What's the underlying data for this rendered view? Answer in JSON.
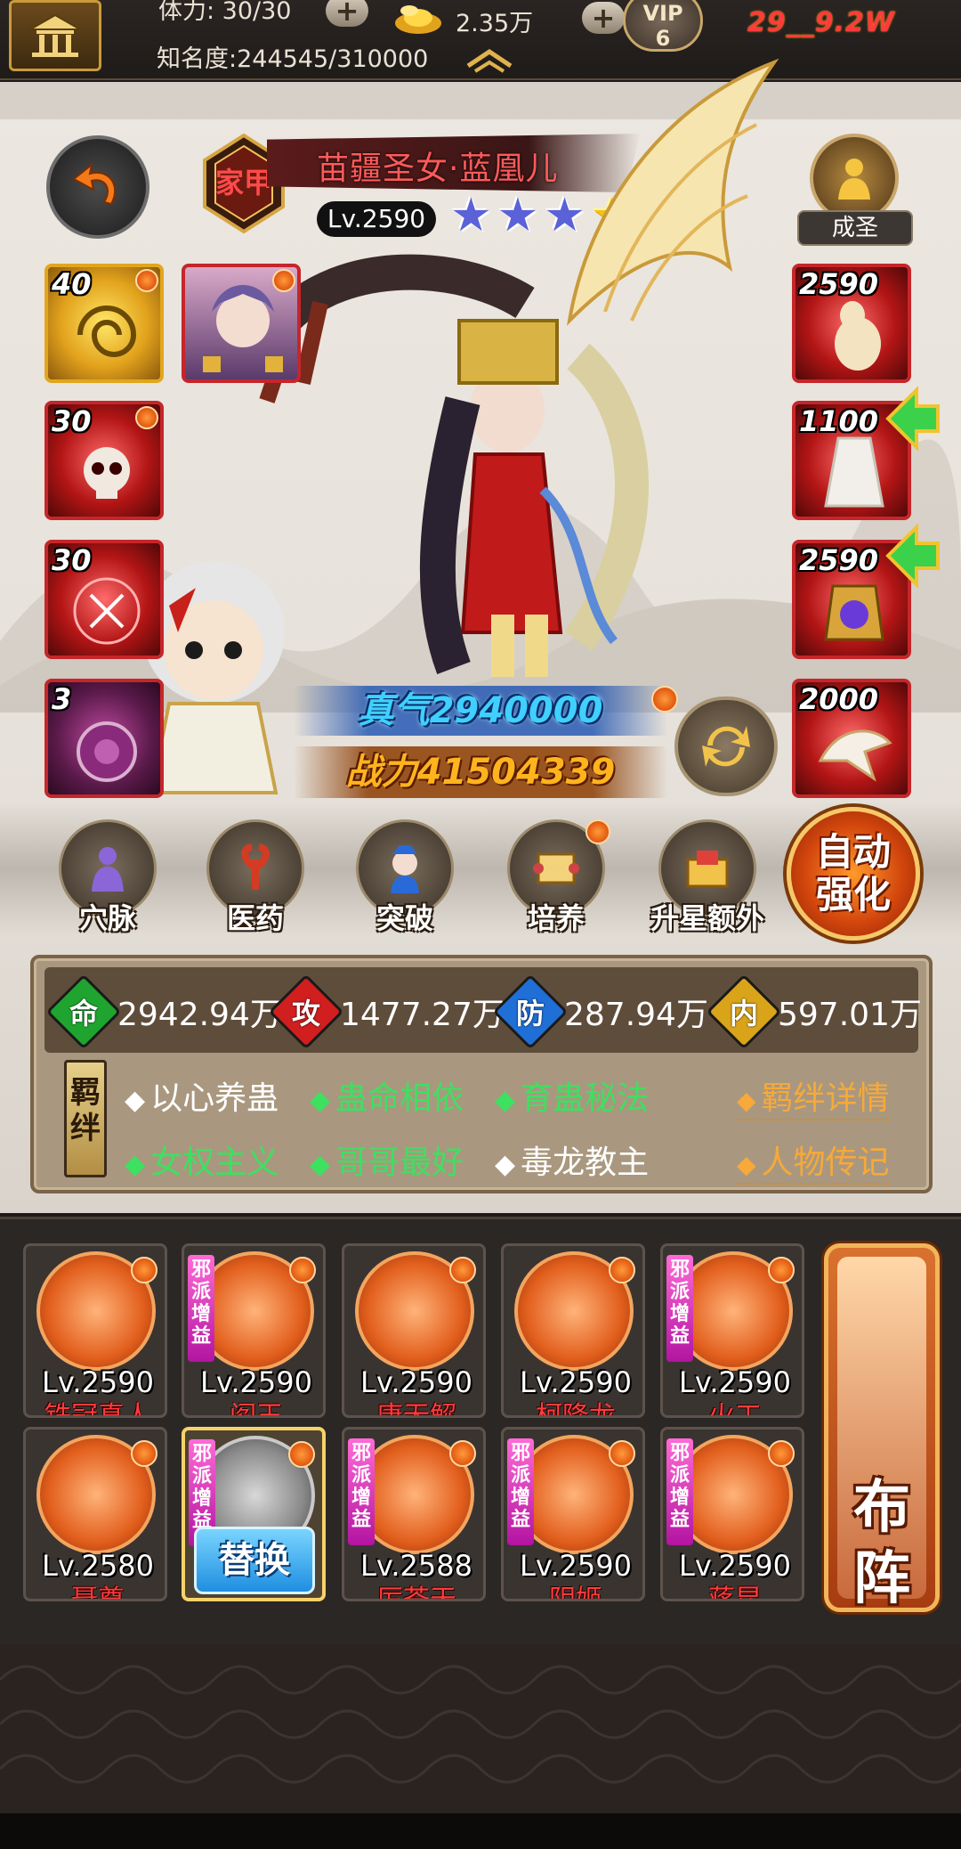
{
  "topbar": {
    "stamina_text": "体力: 30/30",
    "gold_text": "2.35万",
    "vip_label": "VIP",
    "vip_level": "6",
    "power_text": "29__9.2W",
    "fame_text": "知名度:244545/310000"
  },
  "hero": {
    "badge_text": "家甲",
    "name": "苗疆圣女·蓝凰儿",
    "level": "Lv.2590",
    "stars": {
      "blue": 3,
      "gold": 2,
      "total": 5
    },
    "chengsheng_label": "成圣",
    "zhenqi": "真气2940000",
    "zhanli": "战力41504339"
  },
  "equip_left": [
    {
      "num": "40",
      "frame": "gold",
      "icon": "swirl-scroll-icon"
    },
    {
      "num": "",
      "frame": "red",
      "icon": "hero-portrait-icon"
    },
    {
      "num": "30",
      "frame": "red",
      "icon": "skull-icon"
    },
    {
      "num": "30",
      "frame": "red",
      "icon": "talisman-icon"
    },
    {
      "num": "3",
      "frame": "red",
      "icon": "orb-icon"
    }
  ],
  "equip_right": [
    {
      "num": "2590",
      "frame": "red",
      "icon": "gourd-icon"
    },
    {
      "num": "1100",
      "frame": "red",
      "icon": "robe-icon"
    },
    {
      "num": "2590",
      "frame": "red",
      "icon": "incense-burner-icon"
    },
    {
      "num": "2000",
      "frame": "red",
      "icon": "eagle-icon"
    }
  ],
  "actions": [
    {
      "label": "穴脉",
      "icon": "meridian-icon"
    },
    {
      "label": "医药",
      "icon": "herb-icon"
    },
    {
      "label": "突破",
      "icon": "breakthrough-icon"
    },
    {
      "label": "培养",
      "icon": "scroll-icon"
    },
    {
      "label": "升星额外",
      "icon": "star-up-icon"
    }
  ],
  "auto_strengthen_label": "自动强化",
  "stats": [
    {
      "key": "命",
      "value": "2942.94万",
      "color": "#1fa52f"
    },
    {
      "key": "攻",
      "value": "1477.27万",
      "color": "#d11e1e"
    },
    {
      "key": "防",
      "value": "287.94万",
      "color": "#1f6fd6"
    },
    {
      "key": "内",
      "value": "597.01万",
      "color": "#d9a41a"
    }
  ],
  "bond_tag": "羁绊",
  "bonds": [
    {
      "text": "以心养蛊",
      "active": false
    },
    {
      "text": "蛊命相依",
      "active": true
    },
    {
      "text": "育蛊秘法",
      "active": true
    },
    {
      "text": "女权主义",
      "active": true
    },
    {
      "text": "哥哥最好",
      "active": true
    },
    {
      "text": "毒龙教主",
      "active": false
    }
  ],
  "bond_links": [
    "羁绊详情",
    "人物传记"
  ],
  "evil_tag": "邪派增益",
  "team": [
    {
      "level": "Lv.2590",
      "name": "铁冠真人",
      "evil": false
    },
    {
      "level": "Lv.2590",
      "name": "阎王",
      "evil": true
    },
    {
      "level": "Lv.2590",
      "name": "唐无解",
      "evil": false
    },
    {
      "level": "Lv.2590",
      "name": "柯降龙",
      "evil": false
    },
    {
      "level": "Lv.2590",
      "name": "火工",
      "evil": true
    },
    {
      "level": "Lv.2580",
      "name": "聂尊",
      "evil": false
    },
    {
      "level": "",
      "name": "",
      "evil": true,
      "selected": true
    },
    {
      "level": "Lv.2588",
      "name": "厉苍天",
      "evil": true
    },
    {
      "level": "Lv.2590",
      "name": "阴姬",
      "evil": true
    },
    {
      "level": "Lv.2590",
      "name": "蒋昆",
      "evil": true
    }
  ],
  "replace_label": "替换",
  "formation_label_top": "布",
  "formation_label_bottom": "阵"
}
